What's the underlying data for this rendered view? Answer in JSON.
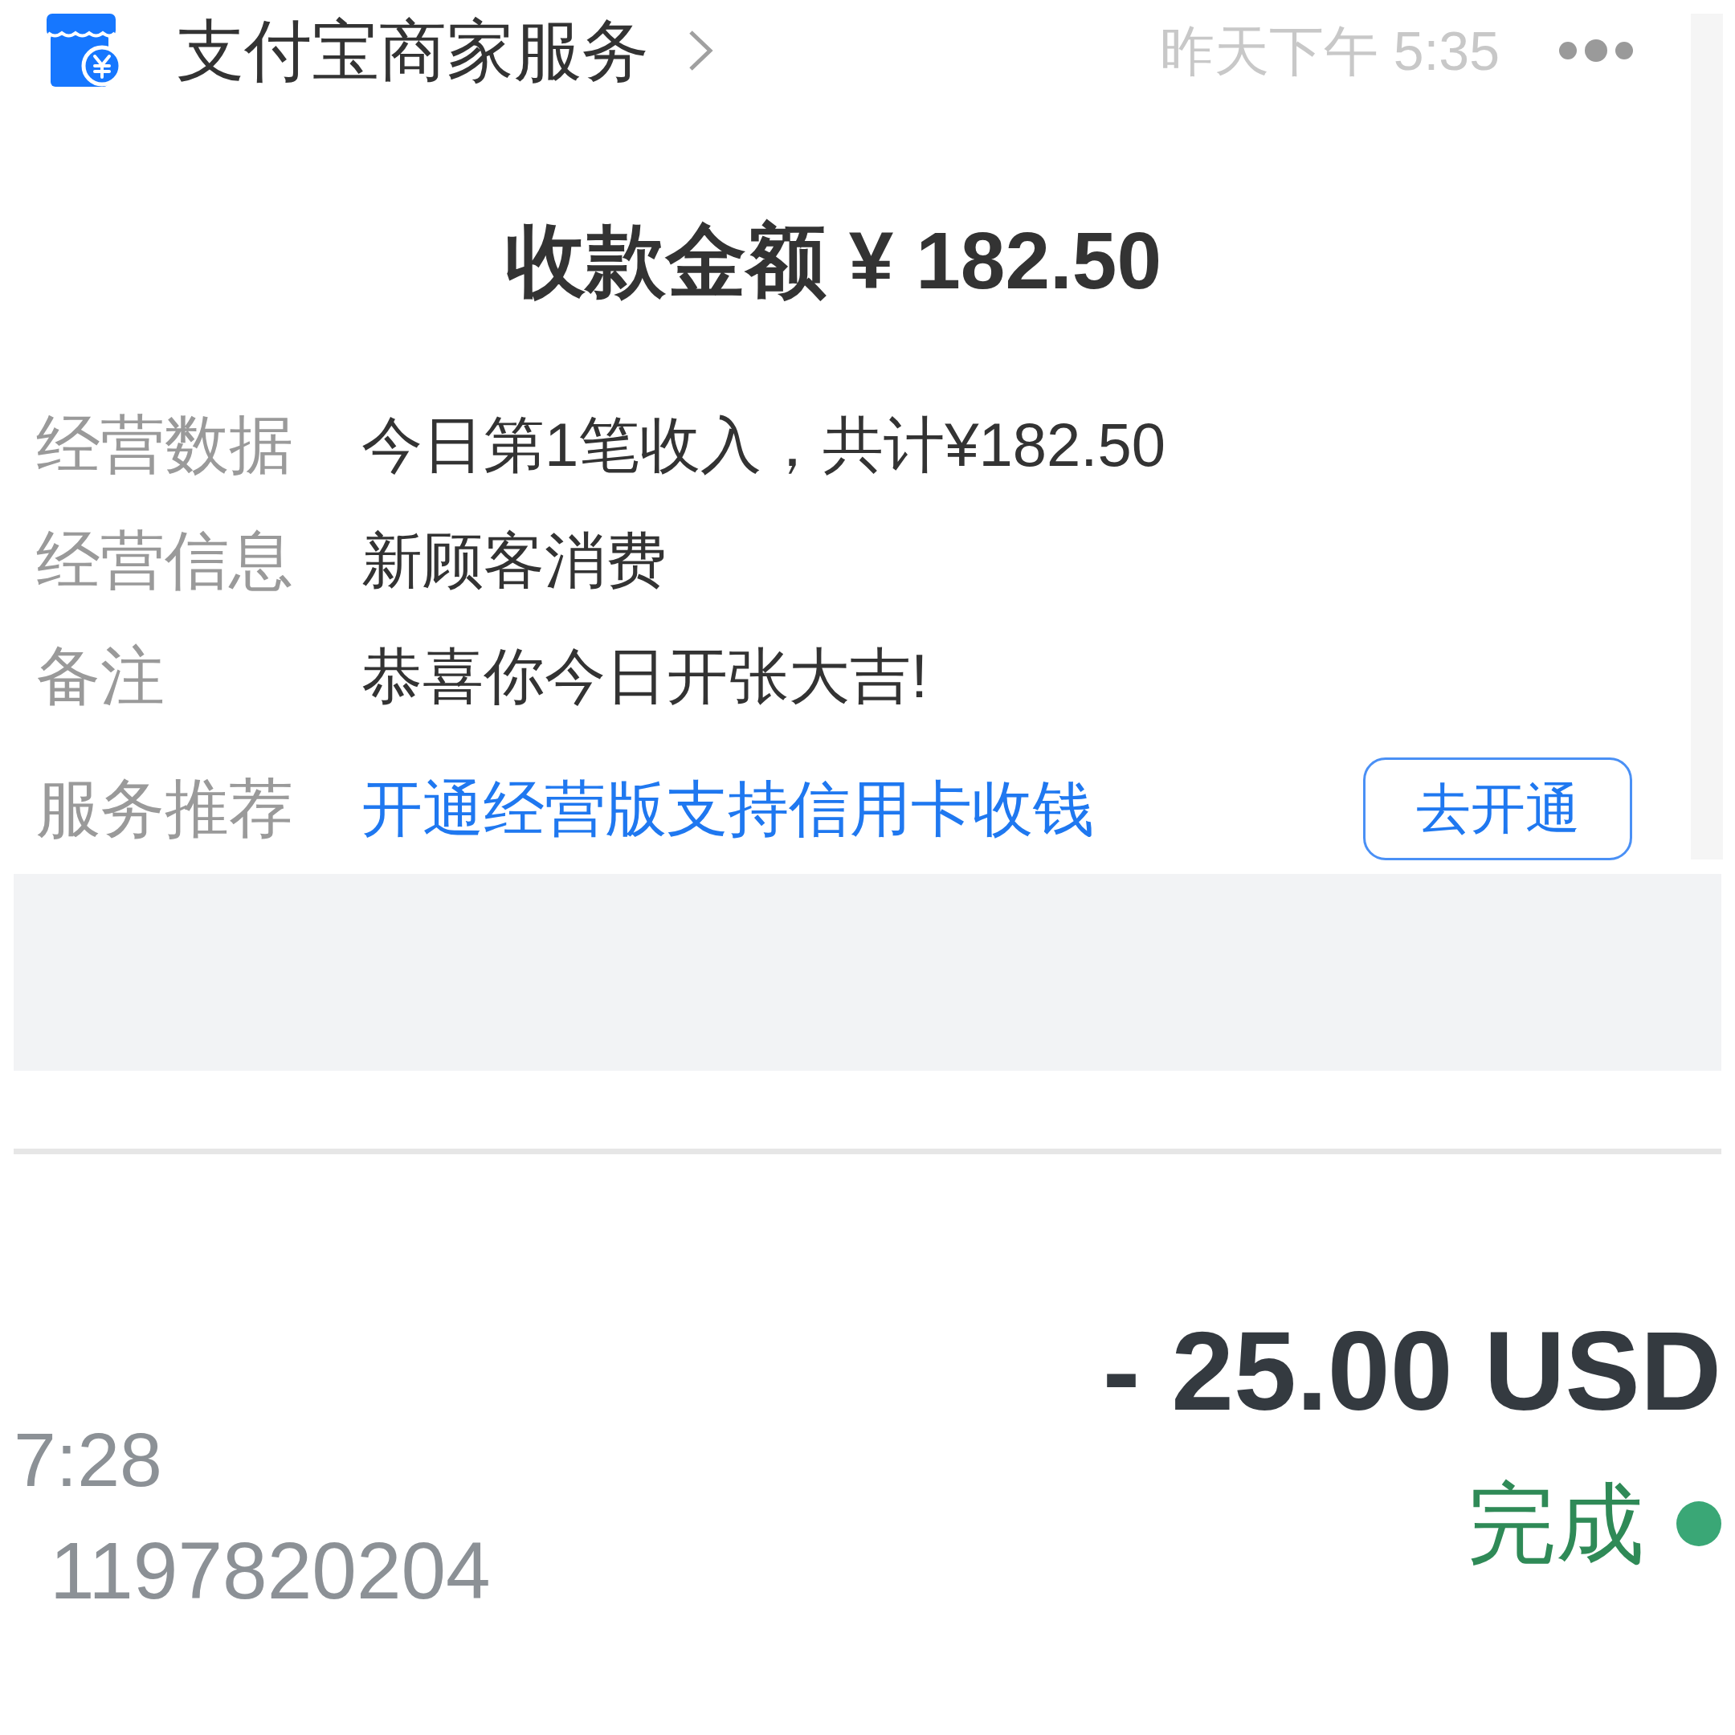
{
  "header": {
    "title": "支付宝商家服务",
    "time": "昨天下午 5:35"
  },
  "payment": {
    "title": "收款金额 ¥ 182.50"
  },
  "details": [
    {
      "label": "经营数据",
      "value": "今日第1笔收入，共计¥182.50",
      "kind": "text"
    },
    {
      "label": "经营信息",
      "value": "新顾客消费",
      "kind": "text"
    },
    {
      "label": "备注",
      "value": "恭喜你今日开张大吉!",
      "kind": "text"
    },
    {
      "label": "服务推荐",
      "value": "开通经营版支持信用卡收钱",
      "kind": "link",
      "action": "去开通"
    }
  ],
  "transaction": {
    "amount": "- 25.00 USD",
    "time": "7:28",
    "number": "1197820204",
    "status": "完成"
  }
}
